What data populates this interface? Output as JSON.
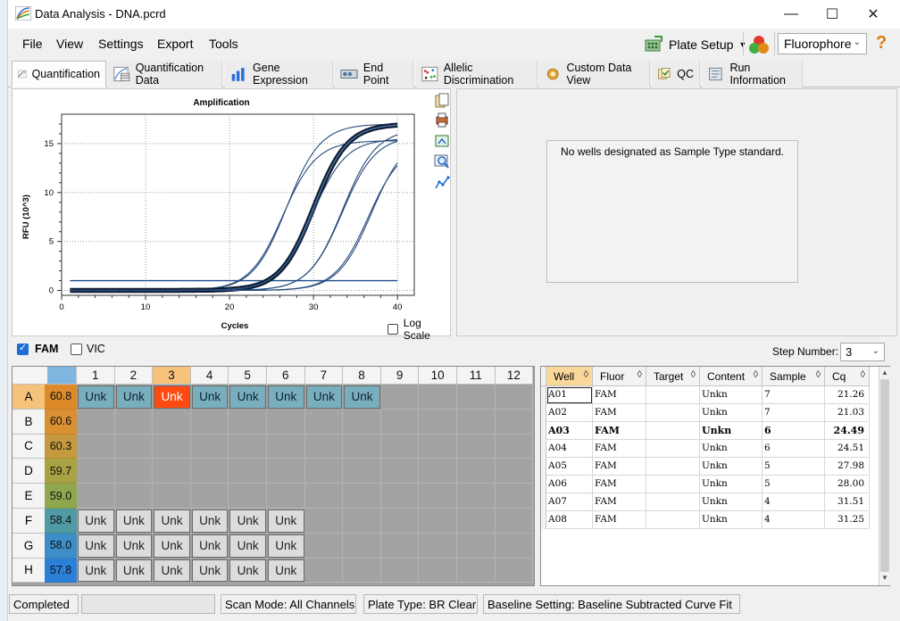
{
  "window": {
    "title": "Data Analysis - DNA.pcrd",
    "minimize": "—",
    "maximize": "☐",
    "close": "✕"
  },
  "menu": {
    "file": "File",
    "view": "View",
    "settings": "Settings",
    "export": "Export",
    "tools": "Tools"
  },
  "toolbar": {
    "plate_setup": "Plate Setup",
    "fluorophore": "Fluorophore",
    "help": "?"
  },
  "tabs": [
    {
      "label": "Quantification",
      "icon": "amplification-curve-icon",
      "active": true
    },
    {
      "label": "Quantification Data",
      "icon": "quant-data-icon"
    },
    {
      "label": "Gene Expression",
      "icon": "bar-chart-icon"
    },
    {
      "label": "End Point",
      "icon": "endpoint-icon"
    },
    {
      "label": "Allelic Discrimination",
      "icon": "allelic-icon"
    },
    {
      "label": "Custom Data View",
      "icon": "gear-icon"
    },
    {
      "label": "QC",
      "icon": "qc-icon"
    },
    {
      "label": "Run Information",
      "icon": "run-info-icon"
    }
  ],
  "std_curve_message": "No wells designated as Sample Type standard.",
  "chart_options": {
    "log_scale": "Log Scale"
  },
  "chart_data": {
    "type": "line",
    "title": "Amplification",
    "xlabel": "Cycles",
    "ylabel": "RFU (10^3)",
    "xlim": [
      0,
      42
    ],
    "ylim": [
      -0.5,
      18
    ],
    "xticks": [
      0,
      10,
      20,
      30,
      40
    ],
    "yticks": [
      0,
      5,
      10,
      15
    ],
    "threshold": 1.0,
    "grid": true,
    "series": [
      {
        "well": "A01",
        "cq": 21.26,
        "plateau": 17.0,
        "selected": false
      },
      {
        "well": "A02",
        "cq": 21.03,
        "plateau": 15.3,
        "selected": false
      },
      {
        "well": "A03",
        "cq": 24.49,
        "plateau": 17.0,
        "selected": true
      },
      {
        "well": "A04",
        "cq": 24.51,
        "plateau": 15.5,
        "selected": false
      },
      {
        "well": "A05",
        "cq": 27.98,
        "plateau": 16.5,
        "selected": false
      },
      {
        "well": "A06",
        "cq": 28.0,
        "plateau": 15.8,
        "selected": false
      },
      {
        "well": "A07",
        "cq": 31.51,
        "plateau": 15.8,
        "selected": false
      },
      {
        "well": "A08",
        "cq": 31.25,
        "plateau": 15.0,
        "selected": false
      }
    ]
  },
  "fluors": {
    "fam": "FAM",
    "vic": "VIC"
  },
  "step_number": {
    "label": "Step Number:",
    "value": "3"
  },
  "plate": {
    "columns": [
      "1",
      "2",
      "3",
      "4",
      "5",
      "6",
      "7",
      "8",
      "9",
      "10",
      "11",
      "12"
    ],
    "rows": [
      {
        "label": "A",
        "temp": "60.8",
        "temp_color": "#dc8a2a",
        "wells": [
          "Unk",
          "Unk",
          "Unk",
          "Unk",
          "Unk",
          "Unk",
          "Unk",
          "Unk"
        ],
        "style": "fam"
      },
      {
        "label": "B",
        "temp": "60.6",
        "temp_color": "#d99033",
        "wells": [],
        "style": ""
      },
      {
        "label": "C",
        "temp": "60.3",
        "temp_color": "#c59a3e",
        "wells": [],
        "style": ""
      },
      {
        "label": "D",
        "temp": "59.7",
        "temp_color": "#a8a244",
        "wells": [],
        "style": ""
      },
      {
        "label": "E",
        "temp": "59.0",
        "temp_color": "#8fa84f",
        "wells": [],
        "style": ""
      },
      {
        "label": "F",
        "temp": "58.4",
        "temp_color": "#4f9aa4",
        "wells": [
          "Unk",
          "Unk",
          "Unk",
          "Unk",
          "Unk",
          "Unk"
        ],
        "style": ""
      },
      {
        "label": "G",
        "temp": "58.0",
        "temp_color": "#3d8ec6",
        "wells": [
          "Unk",
          "Unk",
          "Unk",
          "Unk",
          "Unk",
          "Unk"
        ],
        "style": ""
      },
      {
        "label": "H",
        "temp": "57.8",
        "temp_color": "#2a80d6",
        "wells": [
          "Unk",
          "Unk",
          "Unk",
          "Unk",
          "Unk",
          "Unk"
        ],
        "style": ""
      }
    ],
    "selected_well": "A3"
  },
  "results": {
    "headers": [
      "Well",
      "Fluor",
      "Target",
      "Content",
      "Sample",
      "Cq"
    ],
    "rows": [
      [
        "A01",
        "FAM",
        "",
        "Unkn",
        "7",
        "21.26"
      ],
      [
        "A02",
        "FAM",
        "",
        "Unkn",
        "7",
        "21.03"
      ],
      [
        "A03",
        "FAM",
        "",
        "Unkn",
        "6",
        "24.49"
      ],
      [
        "A04",
        "FAM",
        "",
        "Unkn",
        "6",
        "24.51"
      ],
      [
        "A05",
        "FAM",
        "",
        "Unkn",
        "5",
        "27.98"
      ],
      [
        "A06",
        "FAM",
        "",
        "Unkn",
        "5",
        "28.00"
      ],
      [
        "A07",
        "FAM",
        "",
        "Unkn",
        "4",
        "31.51"
      ],
      [
        "A08",
        "FAM",
        "",
        "Unkn",
        "4",
        "31.25"
      ]
    ],
    "selected_row": 2
  },
  "status": {
    "state": "Completed",
    "scan_mode": "Scan Mode: All Channels",
    "plate_type": "Plate Type: BR Clear",
    "baseline": "Baseline Setting: Baseline Subtracted Curve Fit"
  }
}
